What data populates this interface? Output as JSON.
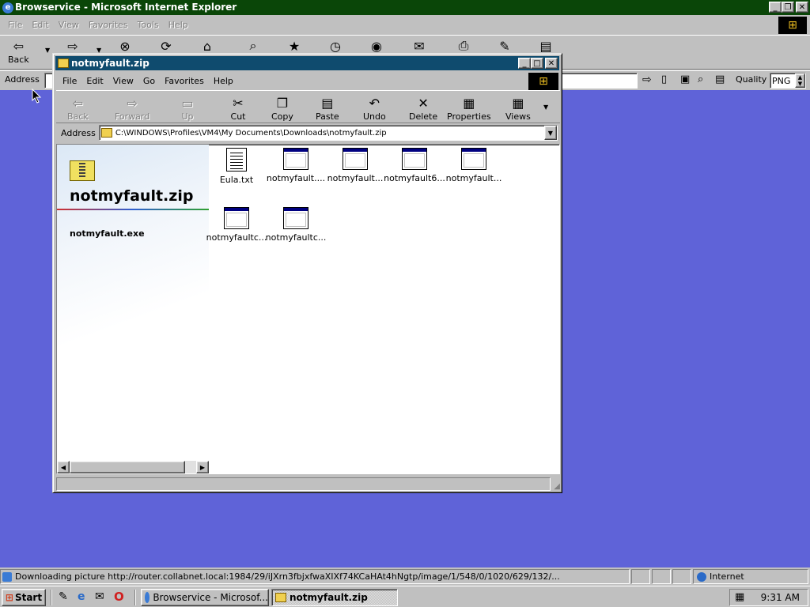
{
  "ie": {
    "title": "Browservice - Microsoft Internet Explorer",
    "menu": [
      "File",
      "Edit",
      "View",
      "Favorites",
      "Tools",
      "Help"
    ],
    "toolbar": {
      "back": "Back"
    },
    "address_label": "Address",
    "quality_label": "Quality",
    "quality_value": "PNG"
  },
  "explorer": {
    "title": "notmyfault.zip",
    "menu": [
      "File",
      "Edit",
      "View",
      "Go",
      "Favorites",
      "Help"
    ],
    "toolbar": {
      "back": "Back",
      "forward": "Forward",
      "up": "Up",
      "cut": "Cut",
      "copy": "Copy",
      "paste": "Paste",
      "undo": "Undo",
      "delete": "Delete",
      "properties": "Properties",
      "views": "Views"
    },
    "address_label": "Address",
    "address_value": "C:\\WINDOWS\\Profiles\\VM4\\My Documents\\Downloads\\notmyfault.zip",
    "panel_title": "notmyfault.zip",
    "panel_subtitle": "notmyfault.exe",
    "files": [
      {
        "name": "Eula.txt",
        "icon": "text-file-icon"
      },
      {
        "name": "notmyfault....",
        "icon": "application-icon"
      },
      {
        "name": "notmyfault...",
        "icon": "application-icon"
      },
      {
        "name": "notmyfault6...",
        "icon": "application-icon"
      },
      {
        "name": "notmyfault...",
        "icon": "application-icon"
      },
      {
        "name": "notmyfaultc...",
        "icon": "application-icon"
      },
      {
        "name": "notmyfaultc...",
        "icon": "application-icon"
      }
    ]
  },
  "statusbar": {
    "text": "Downloading picture http://router.collabnet.local:1984/29/iJXrn3fbjxfwaXIXf74KCaHAt4hNgtp/image/1/548/0/1020/629/132/...",
    "zone": "Internet"
  },
  "taskbar": {
    "start": "Start",
    "tasks": [
      "Browservice - Microsof...",
      "notmyfault.zip"
    ],
    "clock": "9:31 AM"
  },
  "colors": {
    "desktop": "#5f63d8",
    "ie_titlebar": "#0a4608",
    "explorer_titlebar": "#0f4b6e"
  }
}
